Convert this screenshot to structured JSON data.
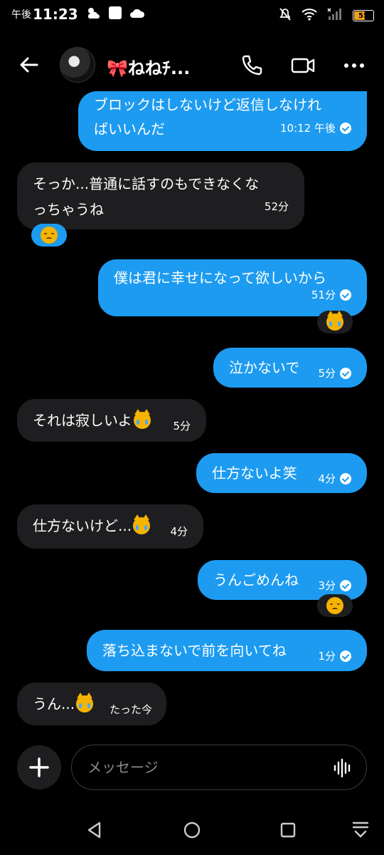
{
  "status_bar": {
    "ampm": "午後",
    "time": "11:23",
    "battery_level": "55"
  },
  "header": {
    "contact_name": "🎀ねねﾁ...",
    "icons": [
      "back-arrow-icon",
      "phone-icon",
      "video-camera-icon",
      "more-horizontal-icon"
    ]
  },
  "messages": [
    {
      "side": "sent",
      "lines": [
        "ブロックはしないけど返信しなけれ",
        "ばいいんだ"
      ],
      "time": "10:12 午後",
      "read": true
    },
    {
      "side": "recv",
      "lines": [
        "そっか...普通に話すのもできなくな",
        "っちゃうね"
      ],
      "time": "52分",
      "reaction": "disappointed-face"
    },
    {
      "side": "sent",
      "lines": [
        "僕は君に幸せになって欲しいから"
      ],
      "time": "51分",
      "read": true,
      "reaction": "crying-cat-face"
    },
    {
      "side": "sent",
      "text": "泣かないで",
      "time": "5分",
      "read": true
    },
    {
      "side": "recv",
      "text": "それは寂しいよ",
      "emoji": "crying-cat-face",
      "time": "5分"
    },
    {
      "side": "sent",
      "text": "仕方ないよ笑",
      "time": "4分",
      "read": true
    },
    {
      "side": "recv",
      "text": "仕方ないけど...",
      "emoji": "crying-cat-face",
      "time": "4分"
    },
    {
      "side": "sent",
      "text": "うんごめんね",
      "time": "3分",
      "read": true,
      "reaction": "disappointed-face"
    },
    {
      "side": "sent",
      "text": "落ち込まないで前を向いてね",
      "time": "1分",
      "read": true
    },
    {
      "side": "recv",
      "text": "うん...",
      "emoji": "crying-cat-face",
      "time": "たった今"
    }
  ],
  "composer": {
    "placeholder": "メッセージ"
  },
  "colors": {
    "sent_bubble": "#1d9bf0",
    "recv_bubble": "#1e1e20",
    "background": "#000000"
  }
}
